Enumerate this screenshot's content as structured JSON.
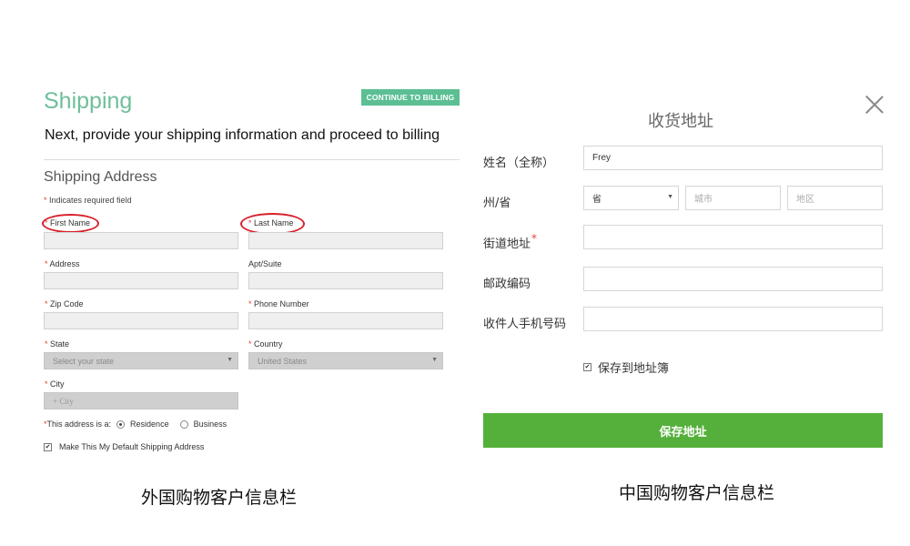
{
  "left_form": {
    "title": "Shipping",
    "continue_button": "CONTINUE TO BILLING",
    "subtitle": "Next, provide your shipping information and proceed to billing",
    "section_heading": "Shipping Address",
    "required_star": "*",
    "required_note": " Indicates required field",
    "fields": {
      "first_name": "First Name",
      "last_name": "Last Name",
      "address": "Address",
      "apt_suite": "Apt/Suite",
      "zip_code": "Zip Code",
      "phone_number": "Phone Number",
      "state": "State",
      "country": "Country",
      "city": "City"
    },
    "state_selected": "Select your state",
    "country_selected": "United States",
    "city_placeholder": "+ City",
    "address_type_label": "This address is a:",
    "address_type_options": [
      "Residence",
      "Business"
    ],
    "address_type_selected": "Residence",
    "default_address_label": "Make This My Default Shipping Address",
    "default_address_checked": true,
    "highlight_color": "#d9202a",
    "accent_color": "#5cbf94"
  },
  "right_form": {
    "title": "收货地址",
    "fields": {
      "name": "姓名（全称）",
      "state_province": "州/省",
      "street": "街道地址",
      "postal_code": "邮政编码",
      "phone": "收件人手机号码"
    },
    "name_value": "Frey",
    "province_selected": "省",
    "city_placeholder": "城市",
    "district_placeholder": "地区",
    "save_to_book_label": "保存到地址簿",
    "save_to_book_checked": true,
    "save_button": "保存地址",
    "button_color": "#55b03b"
  },
  "captions": {
    "left": "外国购物客户信息栏",
    "right": "中国购物客户信息栏"
  },
  "icons": {
    "close": "close-icon",
    "dropdown": "chevron-down-icon",
    "checkbox": "checkmark-icon"
  }
}
